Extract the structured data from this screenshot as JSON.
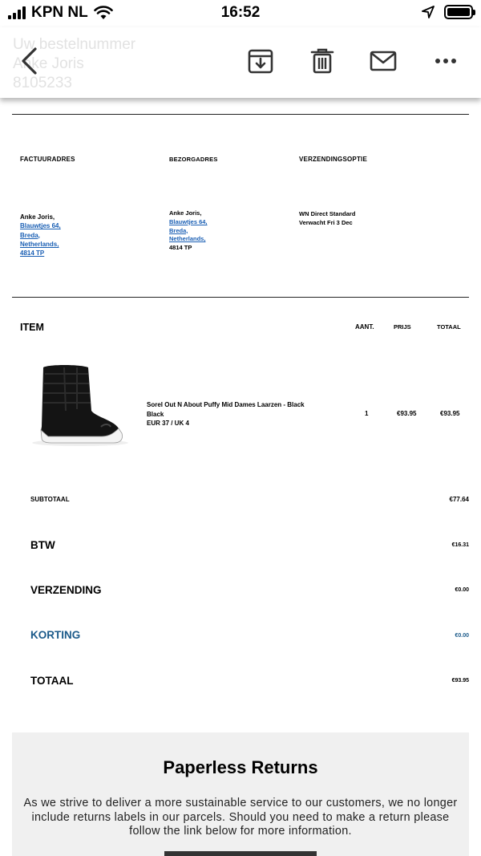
{
  "status_bar": {
    "carrier": "KPN NL",
    "time": "16:52"
  },
  "toolbar": {
    "ghost_lines": [
      "Uw bestelnummer",
      "Anke Joris",
      "8105233"
    ]
  },
  "addresses": {
    "billing": {
      "heading": "FACTUURADRES",
      "name": "Anke Joris,",
      "street": "Blauwtjes 64,",
      "city": "Breda,",
      "country": "Netherlands,",
      "postcode": "4814 TP"
    },
    "shipping": {
      "heading": "BEZORGADRES",
      "name": "Anke Joris,",
      "street": "Blauwtjes 64,",
      "city": "Breda,",
      "country": "Netherlands,",
      "postcode": "4814 TP"
    },
    "delivery": {
      "heading": "VERZENDINGSOPTIE",
      "method": "WN Direct Standard",
      "expected": "Verwacht Fri 3 Dec"
    }
  },
  "items_table": {
    "headers": {
      "item": "ITEM",
      "qty": "AANT.",
      "price": "PRIJS",
      "total": "TOTAAL"
    },
    "rows": [
      {
        "name": "Sorel Out N About Puffy Mid Dames Laarzen - Black",
        "color": "Black",
        "size": "EUR 37 / UK 4",
        "qty": "1",
        "price": "€93.95",
        "total": "€93.95",
        "image_icon": "black-snow-boot-image"
      }
    ]
  },
  "summary": {
    "subtotal": {
      "label": "SUBTOTAAL",
      "value": "€77.64"
    },
    "vat": {
      "label": "BTW",
      "value": "€16.31"
    },
    "shipping": {
      "label": "VERZENDING",
      "value": "€0.00"
    },
    "discount": {
      "label": "KORTING",
      "value": "€0.00"
    },
    "total": {
      "label": "TOTAAL",
      "value": "€93.95"
    }
  },
  "returns": {
    "title": "Paperless Returns",
    "text": "As we strive to deliver a more sustainable service to our customers, we no longer include returns labels in our parcels. Should you need to make a return please follow the link below for more information."
  },
  "colors": {
    "link_blue": "#1a5fb4",
    "discount_blue": "#1b5a8a",
    "returns_bg": "#f0f0f0"
  }
}
